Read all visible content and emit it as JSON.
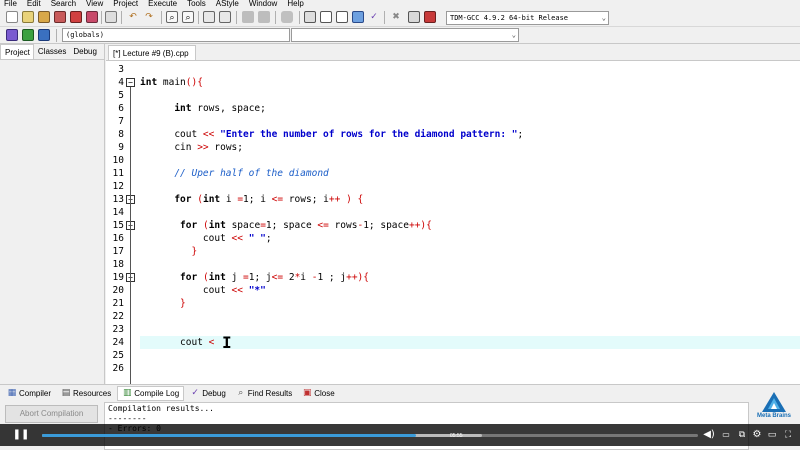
{
  "menu": [
    "File",
    "Edit",
    "Search",
    "View",
    "Project",
    "Execute",
    "Tools",
    "AStyle",
    "Window",
    "Help"
  ],
  "compiler_select": "TDM-GCC 4.9.2 64-bit Release",
  "scope_select": "(globals)",
  "left_tabs": [
    "Project",
    "Classes",
    "Debug"
  ],
  "file_tab": "[*] Lecture #9 (B).cpp",
  "lines": [
    {
      "n": "3",
      "html": ""
    },
    {
      "n": "4",
      "html": "<span class=\"kw\">int</span> main<span class=\"br\">(){</span>"
    },
    {
      "n": "5",
      "html": ""
    },
    {
      "n": "6",
      "html": "      <span class=\"kw\">int</span> rows, space;"
    },
    {
      "n": "7",
      "html": ""
    },
    {
      "n": "8",
      "html": "      cout <span class=\"op\">&lt;&lt;</span> <span class=\"str\">\"Enter the number of rows for the diamond pattern: \"</span>;"
    },
    {
      "n": "9",
      "html": "      cin <span class=\"op\">&gt;&gt;</span> rows;"
    },
    {
      "n": "10",
      "html": ""
    },
    {
      "n": "11",
      "html": "      <span class=\"cmt\">// Uper half of the diamond</span>"
    },
    {
      "n": "12",
      "html": ""
    },
    {
      "n": "13",
      "html": "      <span class=\"kw\">for</span> <span class=\"br\">(</span><span class=\"kw\">int</span> i <span class=\"op\">=</span>1; i <span class=\"op\">&lt;=</span> rows; i<span class=\"op\">++</span> <span class=\"br\">) {</span>"
    },
    {
      "n": "14",
      "html": ""
    },
    {
      "n": "15",
      "html": "       <span class=\"kw\">for</span> <span class=\"br\">(</span><span class=\"kw\">int</span> space<span class=\"op\">=</span>1; space <span class=\"op\">&lt;=</span> rows<span class=\"op\">-</span>1; space<span class=\"op\">++</span><span class=\"br\">){</span>"
    },
    {
      "n": "16",
      "html": "           cout <span class=\"op\">&lt;&lt;</span> <span class=\"str\">\" \"</span>;"
    },
    {
      "n": "17",
      "html": "       <span class=\"br\">  }</span>"
    },
    {
      "n": "18",
      "html": ""
    },
    {
      "n": "19",
      "html": "       <span class=\"kw\">for</span> <span class=\"br\">(</span><span class=\"kw\">int</span> j <span class=\"op\">=</span>1; j<span class=\"op\">&lt;=</span> 2<span class=\"op\">*</span>i <span class=\"op\">-</span>1 ; j<span class=\"op\">++</span><span class=\"br\">){</span>"
    },
    {
      "n": "20",
      "html": "           cout <span class=\"op\">&lt;&lt;</span> <span class=\"str\">\"*\"</span>"
    },
    {
      "n": "21",
      "html": "       <span class=\"br\">}</span>"
    },
    {
      "n": "22",
      "html": ""
    },
    {
      "n": "23",
      "html": ""
    },
    {
      "n": "24",
      "html": "       cout <span class=\"op\">&lt;</span>"
    },
    {
      "n": "25",
      "html": ""
    },
    {
      "n": "26",
      "html": ""
    }
  ],
  "bottom_tabs": [
    {
      "label": "Compiler",
      "icon": "compiler-icon"
    },
    {
      "label": "Resources",
      "icon": "resources-icon"
    },
    {
      "label": "Compile Log",
      "icon": "compile-log-icon"
    },
    {
      "label": "Debug",
      "icon": "debug-icon"
    },
    {
      "label": "Find Results",
      "icon": "find-results-icon"
    },
    {
      "label": "Close",
      "icon": "close-icon"
    }
  ],
  "abort_button": "Abort Compilation",
  "log_text": "Compilation results...\n--------\n- Errors: 0",
  "video": {
    "time": "05:55",
    "played_fraction": 0.57,
    "buffered_fraction": 0.67
  },
  "brand": "Meta Brains",
  "colors": {
    "accent": "#3a9bd9",
    "keyword": "#000000",
    "operator": "#cc0000",
    "string": "#0000cc",
    "comment": "#1c5ec8",
    "current_line": "#e3fbfb"
  }
}
